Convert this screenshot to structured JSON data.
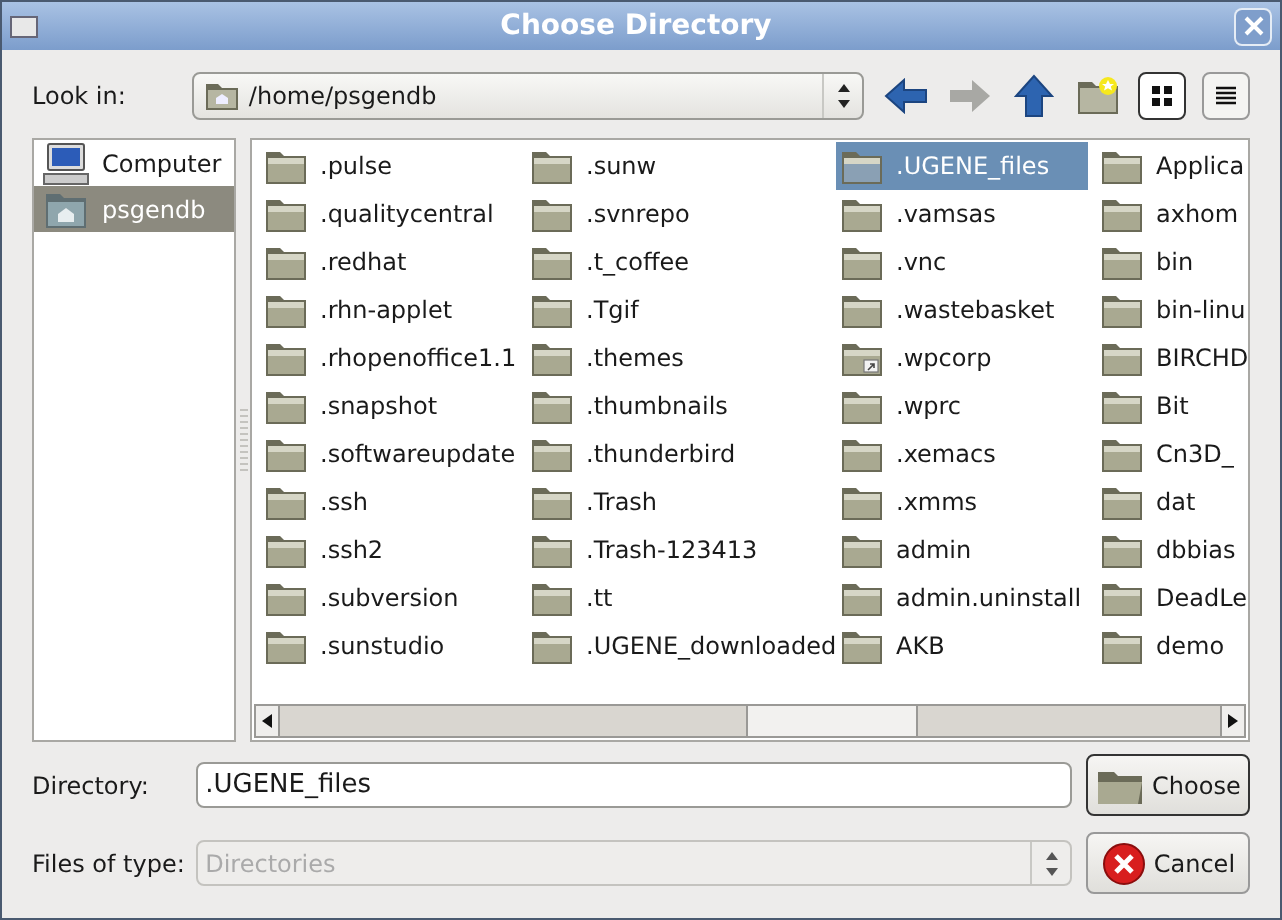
{
  "window": {
    "title": "Choose Directory"
  },
  "look_in": {
    "label": "Look in:",
    "value": "/home/psgendb"
  },
  "view_buttons": [
    {
      "kind": "icons",
      "selected": true
    },
    {
      "kind": "list",
      "selected": false
    }
  ],
  "sidebar": {
    "items": [
      {
        "label": "Computer",
        "kind": "computer",
        "selected": false
      },
      {
        "label": "psgendb",
        "kind": "home",
        "selected": true
      }
    ]
  },
  "files": {
    "columns": [
      [
        {
          "label": ".pulse",
          "kind": "folder",
          "selected": false
        },
        {
          "label": ".qualitycentral",
          "kind": "folder",
          "selected": false
        },
        {
          "label": ".redhat",
          "kind": "folder",
          "selected": false
        },
        {
          "label": ".rhn-applet",
          "kind": "folder",
          "selected": false
        },
        {
          "label": ".rhopenoffice1.1",
          "kind": "folder",
          "selected": false
        },
        {
          "label": ".snapshot",
          "kind": "folder",
          "selected": false
        },
        {
          "label": ".softwareupdate",
          "kind": "folder",
          "selected": false
        },
        {
          "label": ".ssh",
          "kind": "folder",
          "selected": false
        },
        {
          "label": ".ssh2",
          "kind": "folder",
          "selected": false
        },
        {
          "label": ".subversion",
          "kind": "folder",
          "selected": false
        },
        {
          "label": ".sunstudio",
          "kind": "folder",
          "selected": false
        }
      ],
      [
        {
          "label": ".sunw",
          "kind": "folder",
          "selected": false
        },
        {
          "label": ".svnrepo",
          "kind": "folder",
          "selected": false
        },
        {
          "label": ".t_coffee",
          "kind": "folder",
          "selected": false
        },
        {
          "label": ".Tgif",
          "kind": "folder",
          "selected": false
        },
        {
          "label": ".themes",
          "kind": "folder",
          "selected": false
        },
        {
          "label": ".thumbnails",
          "kind": "folder",
          "selected": false
        },
        {
          "label": ".thunderbird",
          "kind": "folder",
          "selected": false
        },
        {
          "label": ".Trash",
          "kind": "folder",
          "selected": false
        },
        {
          "label": ".Trash-123413",
          "kind": "folder",
          "selected": false
        },
        {
          "label": ".tt",
          "kind": "folder",
          "selected": false
        },
        {
          "label": ".UGENE_downloaded",
          "kind": "folder",
          "selected": false
        }
      ],
      [
        {
          "label": ".UGENE_files",
          "kind": "folder",
          "selected": true
        },
        {
          "label": ".vamsas",
          "kind": "folder",
          "selected": false
        },
        {
          "label": ".vnc",
          "kind": "folder",
          "selected": false
        },
        {
          "label": ".wastebasket",
          "kind": "folder",
          "selected": false
        },
        {
          "label": ".wpcorp",
          "kind": "link",
          "selected": false
        },
        {
          "label": ".wprc",
          "kind": "folder",
          "selected": false
        },
        {
          "label": ".xemacs",
          "kind": "folder",
          "selected": false
        },
        {
          "label": ".xmms",
          "kind": "folder",
          "selected": false
        },
        {
          "label": "admin",
          "kind": "folder",
          "selected": false
        },
        {
          "label": "admin.uninstall",
          "kind": "folder",
          "selected": false
        },
        {
          "label": "AKB",
          "kind": "folder",
          "selected": false
        }
      ],
      [
        {
          "label": "Applica",
          "kind": "folder",
          "selected": false
        },
        {
          "label": "axhom",
          "kind": "folder",
          "selected": false
        },
        {
          "label": "bin",
          "kind": "folder",
          "selected": false
        },
        {
          "label": "bin-linu",
          "kind": "folder",
          "selected": false
        },
        {
          "label": "BIRCHD",
          "kind": "folder",
          "selected": false
        },
        {
          "label": "Bit",
          "kind": "folder",
          "selected": false
        },
        {
          "label": "Cn3D_",
          "kind": "folder",
          "selected": false
        },
        {
          "label": "dat",
          "kind": "folder",
          "selected": false
        },
        {
          "label": "dbbias",
          "kind": "folder",
          "selected": false
        },
        {
          "label": "DeadLe",
          "kind": "folder",
          "selected": false
        },
        {
          "label": "demo",
          "kind": "folder",
          "selected": false
        }
      ]
    ]
  },
  "directory": {
    "label": "Directory:",
    "value": ".UGENE_files"
  },
  "files_of_type": {
    "label": "Files of type:",
    "value": "Directories",
    "disabled": true
  },
  "buttons": [
    {
      "label": "Choose",
      "kind": "choose"
    },
    {
      "label": "Cancel",
      "kind": "cancel"
    }
  ]
}
